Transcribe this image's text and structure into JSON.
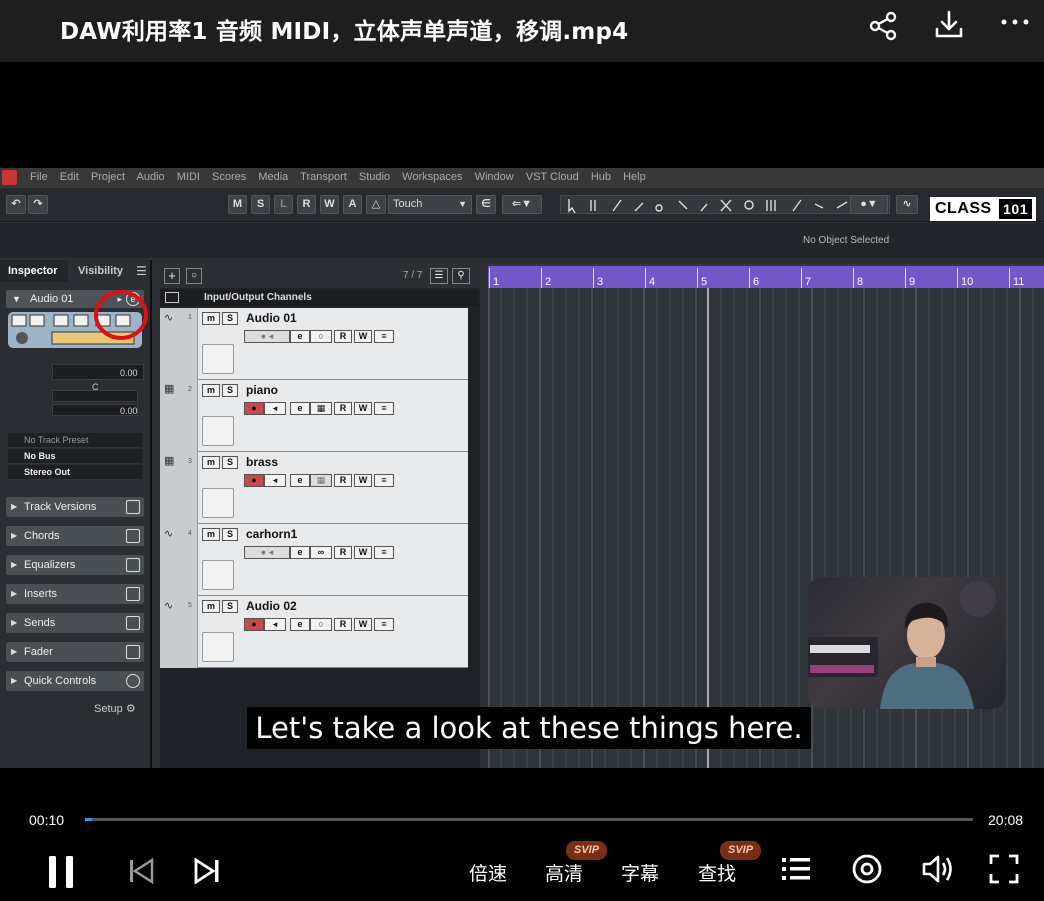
{
  "video": {
    "title": "DAW利用率1 音频 MIDI，立体声单声道，移调.mp4",
    "subtitle_text": "Let's take a look at these things here."
  },
  "daw": {
    "menu": [
      "File",
      "Edit",
      "Project",
      "Audio",
      "MIDI",
      "Scores",
      "Media",
      "Transport",
      "Studio",
      "Workspaces",
      "Window",
      "VST Cloud",
      "Hub",
      "Help"
    ],
    "toolbar": {
      "modes": [
        "M",
        "S",
        "L",
        "R",
        "W",
        "A"
      ],
      "automation_mode": "Touch"
    },
    "status": "No Object Selected",
    "brand": {
      "left": "CLASS",
      "right": "101"
    },
    "inspector": {
      "tabs": [
        "Inspector",
        "Visibility"
      ],
      "track_name": "Audio 01",
      "volume_value": "0.00",
      "pan_label": "C",
      "delay_value": "0.00",
      "preset": "No Track Preset",
      "input_bus": "No Bus",
      "output_bus": "Stereo Out",
      "sections": [
        "Track Versions",
        "Chords",
        "Equalizers",
        "Inserts",
        "Sends",
        "Fader",
        "Quick Controls"
      ],
      "setup_label": "Setup"
    },
    "tracklist": {
      "count": "7 / 7",
      "folder": "Input/Output Channels",
      "tracks": [
        {
          "num": "1",
          "name": "Audio 01",
          "type": "audio",
          "rec": false
        },
        {
          "num": "2",
          "name": "piano",
          "type": "midi",
          "rec": true
        },
        {
          "num": "3",
          "name": "brass",
          "type": "midi",
          "rec": true
        },
        {
          "num": "4",
          "name": "carhorn1",
          "type": "audio",
          "rec": false
        },
        {
          "num": "5",
          "name": "Audio 02",
          "type": "audio",
          "rec": true
        }
      ]
    },
    "ruler": [
      "1",
      "2",
      "3",
      "4",
      "5",
      "6",
      "7",
      "8",
      "9",
      "10",
      "11"
    ]
  },
  "player": {
    "current_time": "00:10",
    "total_time": "20:08",
    "progress_fraction": 0.008,
    "controls": {
      "speed": "倍速",
      "quality": "高清",
      "subtitles": "字幕",
      "search": "查找"
    },
    "badge": "SVIP"
  },
  "colors": {
    "accent": "#1e9bff",
    "ruler": "#7257c9",
    "record": "#c9474f",
    "highlight_ring": "#d11111"
  }
}
